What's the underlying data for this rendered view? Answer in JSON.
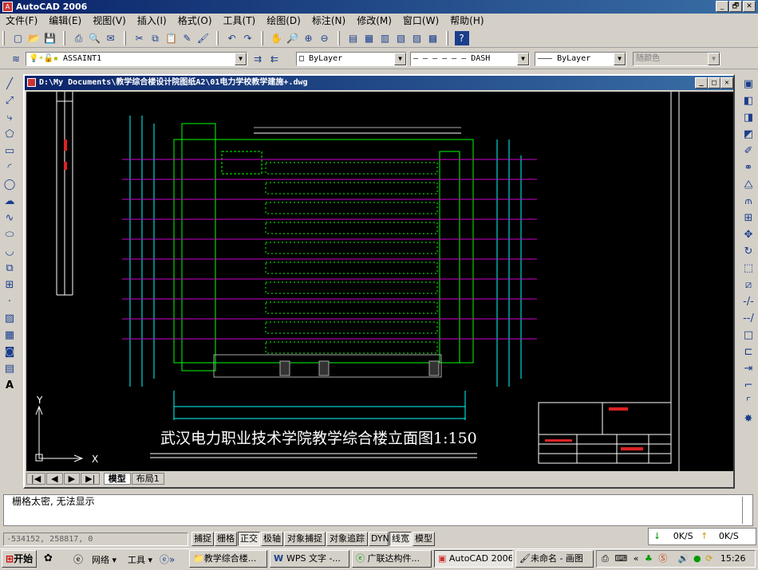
{
  "window": {
    "title": "AutoCAD 2006",
    "icon": "autocad-logo"
  },
  "window_buttons": [
    "_",
    "🗗",
    "✕"
  ],
  "menu": [
    "文件(F)",
    "编辑(E)",
    "视图(V)",
    "插入(I)",
    "格式(O)",
    "工具(T)",
    "绘图(D)",
    "标注(N)",
    "修改(M)",
    "窗口(W)",
    "帮助(H)"
  ],
  "layer": {
    "name": "ASSAINT1",
    "color_combo": "ByLayer",
    "linetype_combo": "DASH",
    "lineweight_combo": "ByLayer",
    "plotstyle_combo": "随颜色"
  },
  "document": {
    "title": "D:\\My Documents\\教学综合楼设计院图纸A2\\01电力学校教学建施+.dwg"
  },
  "drawing": {
    "caption": "武汉电力职业技术学院教学综合楼立面图1:150",
    "ucs_x": "X",
    "ucs_y": "Y"
  },
  "tabs": [
    "模型",
    "布局1"
  ],
  "command": {
    "text": "栅格太密, 无法显示"
  },
  "coords": "-534152, 258817, 0",
  "status_buttons": [
    "捕捉",
    "栅格",
    "正交",
    "极轴",
    "对象捕捉",
    "对象追踪",
    "DYN",
    "线宽",
    "模型"
  ],
  "network": {
    "down": "0K/S",
    "up": "0K/S"
  },
  "taskbar": {
    "start": "开始",
    "quick": [
      "网络 ▾",
      "工具 ▾"
    ],
    "items": [
      "教学综合楼...",
      "WPS 文字 -...",
      "广联达构件...",
      "AutoCAD 2006",
      "未命名 - 画图"
    ]
  },
  "clock": "15:26"
}
